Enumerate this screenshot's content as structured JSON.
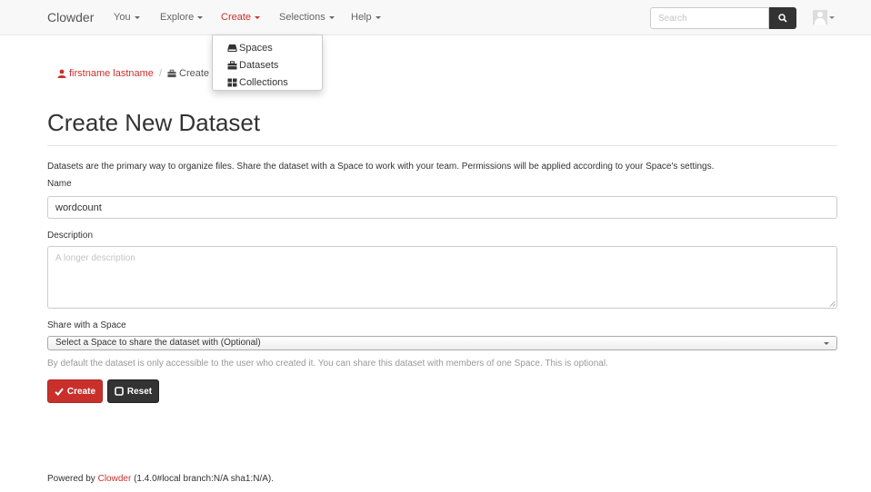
{
  "navbar": {
    "brand": "Clowder",
    "menu": [
      {
        "label": "You"
      },
      {
        "label": "Explore"
      },
      {
        "label": "Create"
      },
      {
        "label": "Selections"
      },
      {
        "label": "Help"
      }
    ],
    "search_placeholder": "Search",
    "accent_color": "#c9302c"
  },
  "create_dropdown": {
    "items": [
      {
        "label": "Spaces",
        "icon": "hdd-icon"
      },
      {
        "label": "Datasets",
        "icon": "briefcase-icon"
      },
      {
        "label": "Collections",
        "icon": "th-large-icon"
      }
    ]
  },
  "breadcrumb": {
    "user": "firstname lastname",
    "separator": "/",
    "current": "Create N"
  },
  "page": {
    "title": "Create New Dataset",
    "intro": "Datasets are the primary way to organize files. Share the dataset with a Space to work with your team. Permissions will be applied according to your Space's settings."
  },
  "form": {
    "name_label": "Name",
    "name_value": "wordcount",
    "description_label": "Description",
    "description_placeholder": "A longer description",
    "space_label": "Share with a Space",
    "space_selected": "Select a Space to share the dataset with (Optional)",
    "space_help": "By default the dataset is only accessible to the user who created it. You can share this dataset with members of one Space. This is optional.",
    "create_label": "Create",
    "reset_label": "Reset"
  },
  "footer": {
    "prefix": "Powered by",
    "link": "Clowder",
    "version": "(1.4.0#local branch:N/A sha1:N/A)."
  }
}
